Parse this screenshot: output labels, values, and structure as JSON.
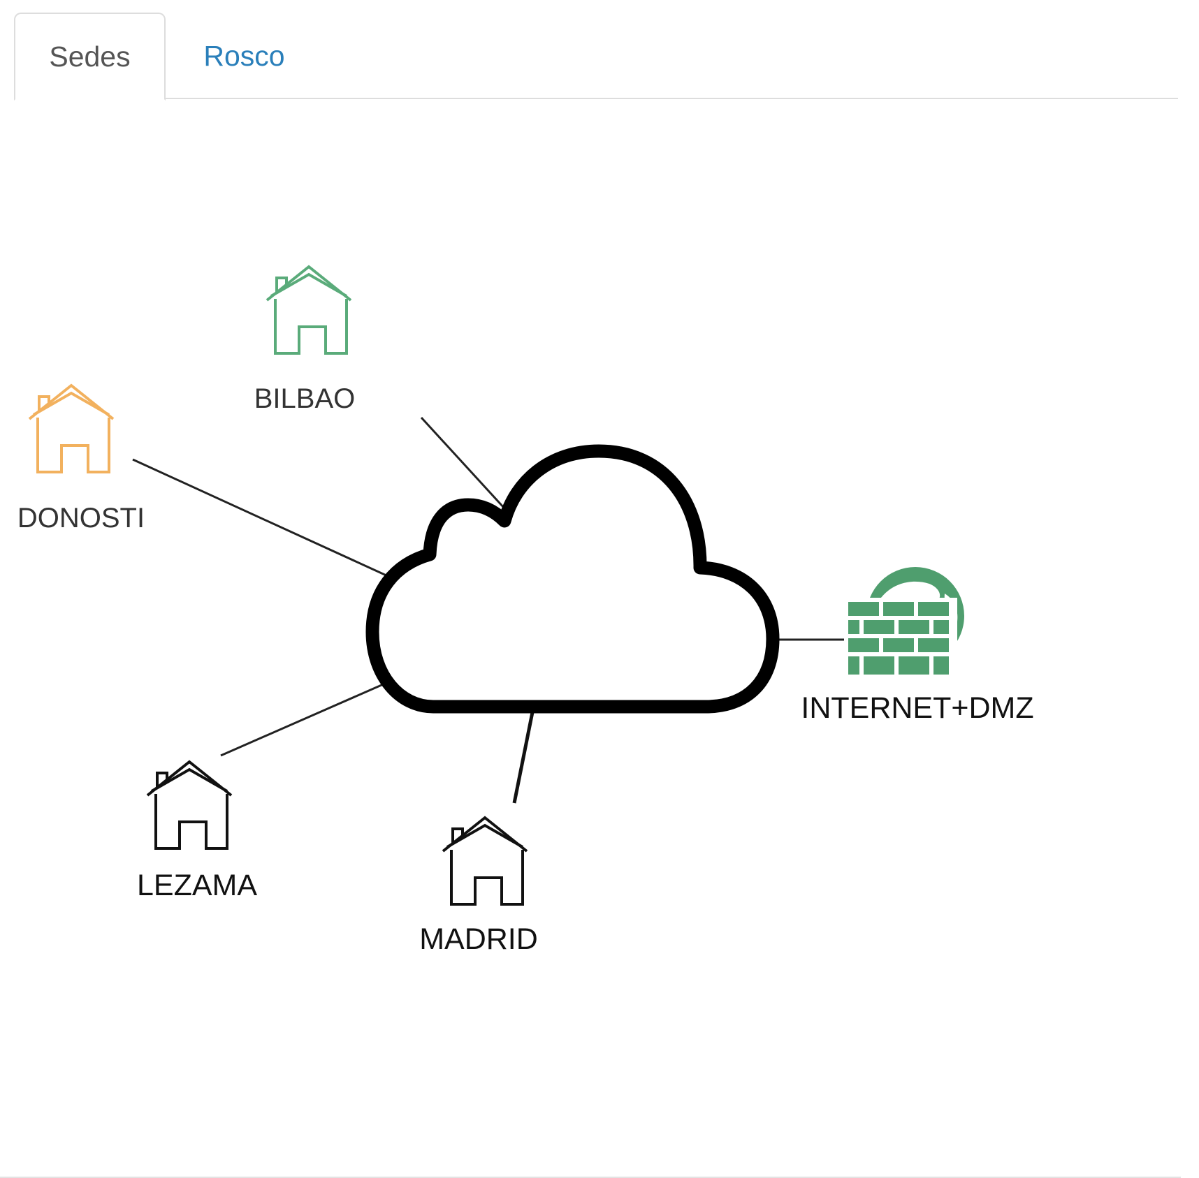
{
  "tabs": [
    {
      "label": "Sedes",
      "active": true
    },
    {
      "label": "Rosco",
      "active": false
    }
  ],
  "nodes": {
    "bilbao": {
      "label": "BILBAO",
      "icon": "house-icon",
      "color": "#5aab7a"
    },
    "donosti": {
      "label": "DONOSTI",
      "icon": "house-icon",
      "color": "#f2b15e"
    },
    "lezama": {
      "label": "LEZAMA",
      "icon": "house-icon",
      "color": "#111111"
    },
    "madrid": {
      "label": "MADRID",
      "icon": "house-icon",
      "color": "#111111"
    },
    "internet": {
      "label": "INTERNET+DMZ",
      "icon": "firewall-globe-icon",
      "color": "#4f9e6e"
    },
    "cloud": {
      "icon": "cloud-icon",
      "color": "#000000"
    }
  },
  "colors": {
    "tab_active_text": "#555555",
    "tab_link": "#2a7fba",
    "label_gray": "#333333",
    "label_dark": "#111111"
  }
}
